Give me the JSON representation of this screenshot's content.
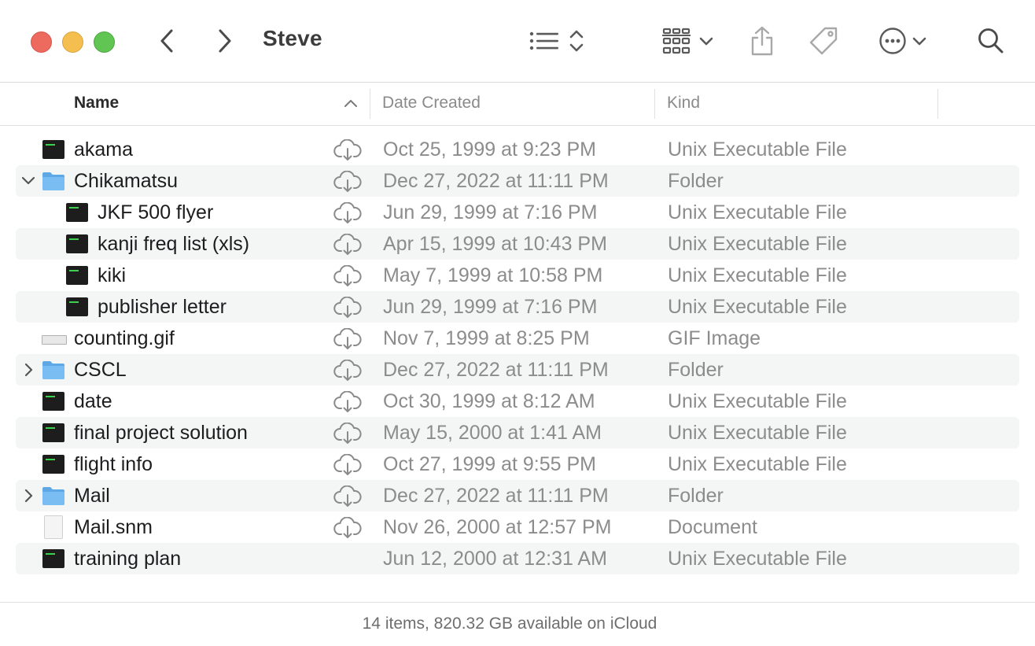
{
  "window": {
    "title": "Steve"
  },
  "toolbar": {
    "icons": [
      "back-icon",
      "forward-icon",
      "list-view-icon",
      "sort-chevrons-icon",
      "group-by-icon",
      "chevron-down-icon",
      "share-icon",
      "tag-icon",
      "more-icon",
      "chevron-down-icon",
      "search-icon"
    ],
    "colors": {
      "close": "#ed6a5e",
      "minimize": "#f5bf4f",
      "zoom": "#61c554"
    }
  },
  "columns": {
    "name": "Name",
    "date": "Date Created",
    "kind": "Kind"
  },
  "rows": [
    {
      "name": "akama",
      "date": "Oct 25, 1999 at 9:23 PM",
      "kind": "Unix Executable File",
      "icon": "unix-executable-icon",
      "disclosure": "",
      "cloud": true
    },
    {
      "name": "Chikamatsu",
      "date": "Dec 27, 2022 at 11:11 PM",
      "kind": "Folder",
      "icon": "folder-icon",
      "disclosure": "expanded",
      "cloud": true
    },
    {
      "name": "JKF 500 flyer",
      "date": "Jun 29, 1999 at 7:16 PM",
      "kind": "Unix Executable File",
      "icon": "unix-executable-icon",
      "disclosure": "",
      "cloud": true
    },
    {
      "name": "kanji freq list (xls)",
      "date": "Apr 15, 1999 at 10:43 PM",
      "kind": "Unix Executable File",
      "icon": "unix-executable-icon",
      "disclosure": "",
      "cloud": true
    },
    {
      "name": "kiki",
      "date": "May 7, 1999 at 10:58 PM",
      "kind": "Unix Executable File",
      "icon": "unix-executable-icon",
      "disclosure": "",
      "cloud": true
    },
    {
      "name": "publisher letter",
      "date": "Jun 29, 1999 at 7:16 PM",
      "kind": "Unix Executable File",
      "icon": "unix-executable-icon",
      "disclosure": "",
      "cloud": true
    },
    {
      "name": "counting.gif",
      "date": "Nov 7, 1999 at 8:25 PM",
      "kind": "GIF Image",
      "icon": "gif-image-icon",
      "disclosure": "",
      "cloud": true
    },
    {
      "name": "CSCL",
      "date": "Dec 27, 2022 at 11:11 PM",
      "kind": "Folder",
      "icon": "folder-icon",
      "disclosure": "collapsed",
      "cloud": true
    },
    {
      "name": "date",
      "date": "Oct 30, 1999 at 8:12 AM",
      "kind": "Unix Executable File",
      "icon": "unix-executable-icon",
      "disclosure": "",
      "cloud": true
    },
    {
      "name": "final project solution",
      "date": "May 15, 2000 at 1:41 AM",
      "kind": "Unix Executable File",
      "icon": "unix-executable-icon",
      "disclosure": "",
      "cloud": true
    },
    {
      "name": "flight info",
      "date": "Oct 27, 1999 at 9:55 PM",
      "kind": "Unix Executable File",
      "icon": "unix-executable-icon",
      "disclosure": "",
      "cloud": true
    },
    {
      "name": "Mail",
      "date": "Dec 27, 2022 at 11:11 PM",
      "kind": "Folder",
      "icon": "folder-icon",
      "disclosure": "collapsed",
      "cloud": true
    },
    {
      "name": "Mail.snm",
      "date": "Nov 26, 2000 at 12:57 PM",
      "kind": "Document",
      "icon": "document-icon",
      "disclosure": "",
      "cloud": true
    },
    {
      "name": "training plan",
      "date": "Jun 12, 2000 at 12:31 AM",
      "kind": "Unix Executable File",
      "icon": "unix-executable-icon",
      "disclosure": "",
      "cloud": false
    }
  ],
  "status": {
    "text": "14 items, 820.32 GB available on iCloud"
  }
}
